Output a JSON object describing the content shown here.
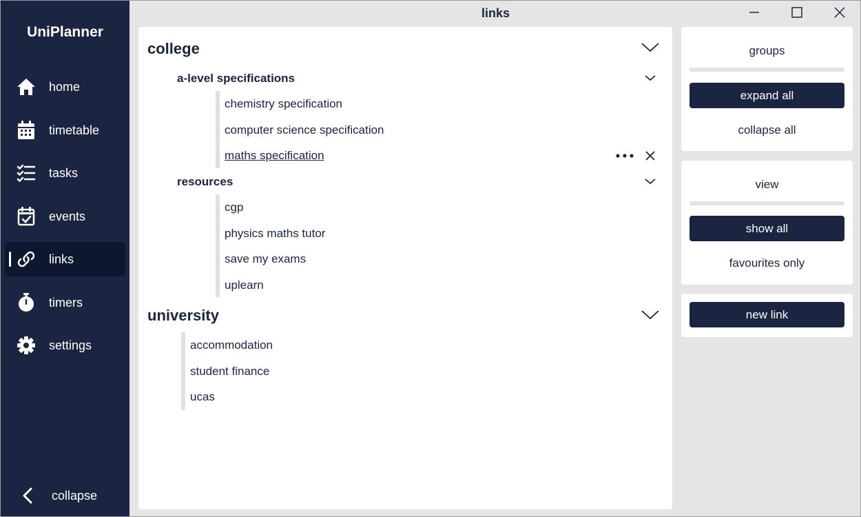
{
  "app": {
    "name": "UniPlanner"
  },
  "window": {
    "title": "links"
  },
  "sidebar": {
    "items": [
      {
        "label": "home",
        "icon": "home-icon"
      },
      {
        "label": "timetable",
        "icon": "calendar-icon"
      },
      {
        "label": "tasks",
        "icon": "checklist-icon"
      },
      {
        "label": "events",
        "icon": "calendar-check-icon"
      },
      {
        "label": "links",
        "icon": "link-icon",
        "active": true
      },
      {
        "label": "timers",
        "icon": "stopwatch-icon"
      },
      {
        "label": "settings",
        "icon": "gear-icon"
      }
    ],
    "collapse_label": "collapse"
  },
  "groups": [
    {
      "title": "college",
      "subgroups": [
        {
          "title": "a-level specifications",
          "links": [
            "chemistry specification",
            "computer science specification",
            "maths specification"
          ]
        },
        {
          "title": "resources",
          "links": [
            "cgp",
            "physics maths tutor",
            "save my exams",
            "uplearn"
          ]
        }
      ]
    },
    {
      "title": "university",
      "links": [
        "accommodation",
        "student finance",
        "ucas"
      ]
    }
  ],
  "panels": {
    "groups": {
      "title": "groups",
      "primary": "expand all",
      "secondary": "collapse all"
    },
    "view": {
      "title": "view",
      "primary": "show all",
      "secondary": "favourites only"
    },
    "new_link": "new link"
  },
  "colors": {
    "sidebar": "#1b2440",
    "sidebar_active": "#0e1730",
    "background": "#e5e5e5",
    "panel": "#ffffff",
    "accent": "#1b2440"
  }
}
